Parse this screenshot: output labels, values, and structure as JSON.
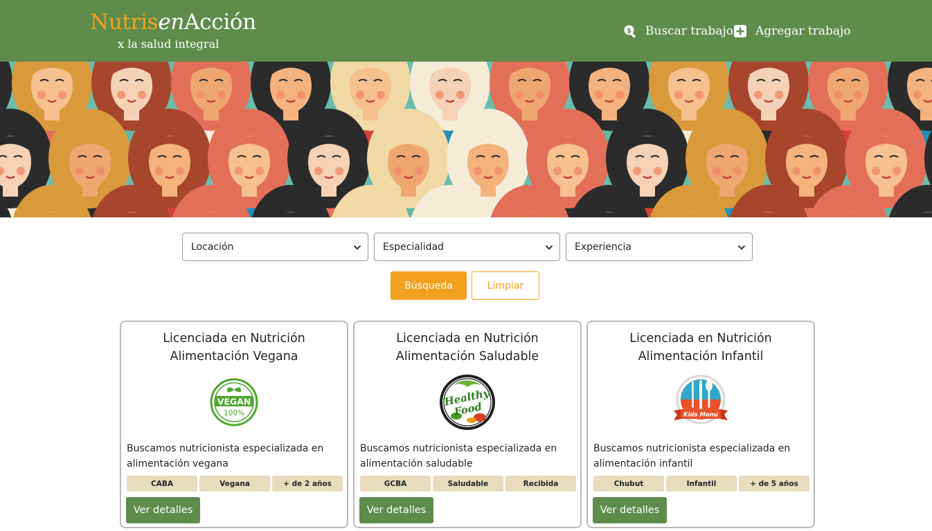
{
  "navbar": {
    "brand_part1": "Nutris",
    "brand_part2": "en",
    "brand_part3": "Acción",
    "brand_subtitle": "x la salud integral",
    "search_job_label": "Buscar trabajo",
    "add_job_label": "Agregar trabajo",
    "icons": {
      "search": "search-dollar-icon",
      "add": "plus-square-icon"
    },
    "colors": {
      "background": "#5f8c4b",
      "brand_accent": "#f3a01e"
    }
  },
  "hero": {
    "image": "illustration of many diverse women faces"
  },
  "filters": {
    "location": {
      "selected": "Locación"
    },
    "specialty": {
      "selected": "Especialidad"
    },
    "experience": {
      "selected": "Experiencia"
    }
  },
  "actions": {
    "search_label": "Búsqueda",
    "clear_label": "Limpiar",
    "search_color": "#f3a01e"
  },
  "cards": [
    {
      "title": "Licenciada en Nutrición Alimentación Vegana",
      "logo": "vegan-100-logo",
      "logo_text": "VEGAN",
      "logo_subtext": "100%",
      "description": "Buscamos nutricionista especializada en alimentación vegana",
      "tags": [
        "CABA",
        "Vegana",
        "+ de 2 años"
      ],
      "button_label": "Ver detalles"
    },
    {
      "title": "Licenciada en Nutrición Alimentación Saludable",
      "logo": "healthy-food-logo",
      "logo_text": "Healthy",
      "logo_subtext": "Food",
      "description": "Buscamos nutricionista especializada en alimentación saludable",
      "tags": [
        "GCBA",
        "Saludable",
        "Recibida"
      ],
      "button_label": "Ver detalles"
    },
    {
      "title": "Licenciada en Nutrición Alimentación Infantil",
      "logo": "kids-menu-logo",
      "logo_text": "Kids Menu",
      "description": "Buscamos nutricionista especializada en alimentación infantil",
      "tags": [
        "Chubut",
        "Infantil",
        "+ de 5 años"
      ],
      "button_label": "Ver detalles"
    }
  ]
}
